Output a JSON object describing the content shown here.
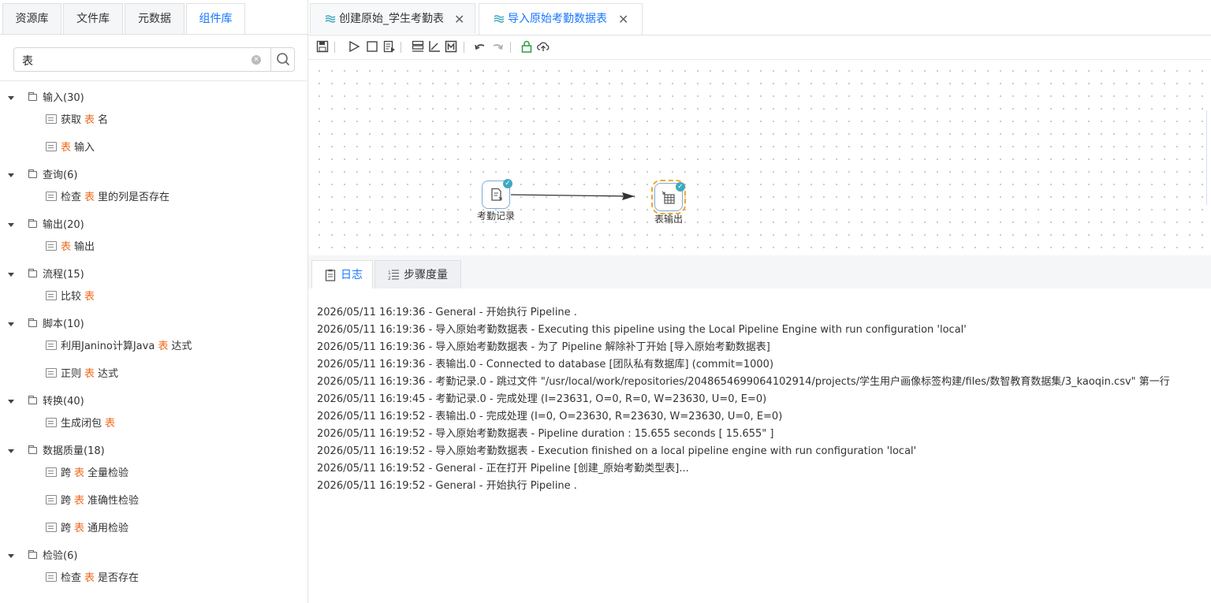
{
  "left_tabs": [
    "资源库",
    "文件库",
    "元数据",
    "组件库"
  ],
  "active_left_tab": "组件库",
  "search": {
    "value": "表",
    "placeholder": "",
    "clear_icon": "clear-circle-icon",
    "search_icon": "search-icon"
  },
  "tree": [
    {
      "label": "输入(30)",
      "children": [
        [
          "获取",
          "表",
          "名"
        ],
        [
          "",
          "表",
          "输入"
        ]
      ]
    },
    {
      "label": "查询(6)",
      "children": [
        [
          "检查",
          "表",
          "里的列是否存在"
        ]
      ]
    },
    {
      "label": "输出(20)",
      "children": [
        [
          "",
          "表",
          "输出"
        ]
      ]
    },
    {
      "label": "流程(15)",
      "children": [
        [
          "比较",
          "表",
          ""
        ]
      ]
    },
    {
      "label": "脚本(10)",
      "children": [
        [
          "利用Janino计算Java",
          "表",
          "达式"
        ],
        [
          "正则",
          "表",
          "达式"
        ]
      ]
    },
    {
      "label": "转换(40)",
      "children": [
        [
          "生成闭包",
          "表",
          ""
        ]
      ]
    },
    {
      "label": "数据质量(18)",
      "children": [
        [
          "跨",
          "表",
          "全量检验"
        ],
        [
          "跨",
          "表",
          "准确性检验"
        ],
        [
          "跨",
          "表",
          "通用检验"
        ]
      ]
    },
    {
      "label": "检验(6)",
      "children": [
        [
          "检查",
          "表",
          "是否存在"
        ]
      ]
    }
  ],
  "editor_tabs": [
    {
      "label": "创建原始_学生考勤表",
      "active": false
    },
    {
      "label": "导入原始考勤数据表",
      "active": true
    }
  ],
  "toolbar_icons": [
    "save-icon",
    "run-icon",
    "stop-icon",
    "preview-icon",
    "layout-icon",
    "axis-icon",
    "metrics-icon",
    "undo-icon",
    "redo-icon",
    "lock-icon",
    "upload-icon"
  ],
  "nodes": [
    {
      "label": "考勤记录",
      "status": "success"
    },
    {
      "label": "表输出",
      "status": "success"
    }
  ],
  "bottom_tabs": [
    {
      "label": "日志",
      "active": true
    },
    {
      "label": "步骤度量",
      "active": false
    }
  ],
  "log_lines": [
    "2026/05/11 16:19:36 - General - 开始执行 Pipeline .",
    "2026/05/11 16:19:36 - 导入原始考勤数据表 - Executing this pipeline using the Local Pipeline Engine with run configuration 'local'",
    "2026/05/11 16:19:36 - 导入原始考勤数据表 - 为了 Pipeline 解除补丁开始 [导入原始考勤数据表]",
    "2026/05/11 16:19:36 - 表输出.0 - Connected to database [团队私有数据库] (commit=1000)",
    "2026/05/11 16:19:36 - 考勤记录.0 - 跳过文件 \"/usr/local/work/repositories/2048654699064102914/projects/学生用户画像标签构建/files/数智教育数据集/3_kaoqin.csv\" 第一行",
    "2026/05/11 16:19:45 - 考勤记录.0 - 完成处理 (I=23631, O=0, R=0, W=23630, U=0, E=0)",
    "2026/05/11 16:19:52 - 表输出.0 - 完成处理 (I=0, O=23630, R=23630, W=23630, U=0, E=0)",
    "2026/05/11 16:19:52 - 导入原始考勤数据表 - Pipeline duration : 15.655 seconds [ 15.655\" ]",
    "2026/05/11 16:19:52 - 导入原始考勤数据表 - Execution finished on a local pipeline engine with run configuration 'local'",
    "2026/05/11 16:19:52 - General - 正在打开 Pipeline [创建_原始考勤类型表]...",
    "2026/05/11 16:19:52 - General - 开始执行 Pipeline ."
  ]
}
